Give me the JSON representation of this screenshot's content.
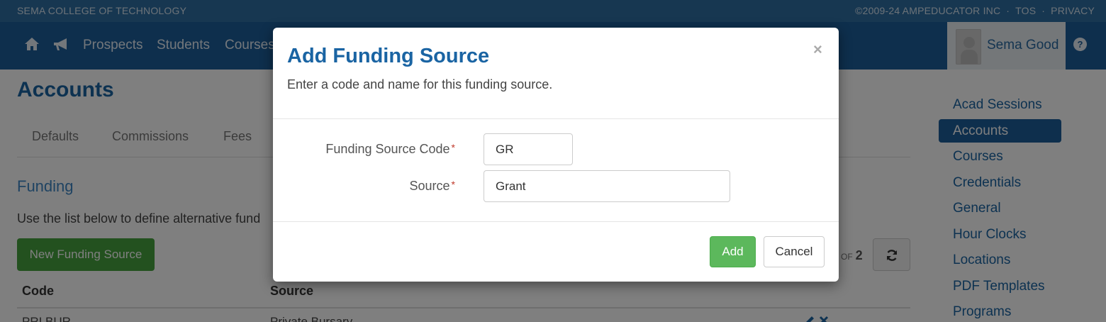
{
  "topbar": {
    "school": "SEMA COLLEGE OF TECHNOLOGY",
    "copyright": "©2009-24 AMPEDUCATOR INC",
    "tos": "TOS",
    "privacy": "PRIVACY",
    "separator": "·"
  },
  "nav": {
    "icons": [
      "home-icon",
      "megaphone-icon"
    ],
    "items": [
      "Prospects",
      "Students",
      "Courses"
    ],
    "user_name": "Sema Good",
    "help_icon": "question-circle-icon"
  },
  "page": {
    "title": "Accounts",
    "tabs": [
      "Defaults",
      "Commissions",
      "Fees"
    ],
    "section_title": "Funding",
    "description": "Use the list below to define alternative fund",
    "new_button": "New Funding Source",
    "of_label": "OF",
    "of_total": "2",
    "table": {
      "headers": [
        "Code",
        "Source"
      ],
      "rows": [
        [
          "PRI BUR",
          "Private Bursary"
        ]
      ]
    }
  },
  "sidebar": {
    "items": [
      "Acad Sessions",
      "Accounts",
      "Courses",
      "Credentials",
      "General",
      "Hour Clocks",
      "Locations",
      "PDF Templates",
      "Programs"
    ],
    "active": "Accounts"
  },
  "modal": {
    "title": "Add Funding Source",
    "subtitle": "Enter a code and name for this funding source.",
    "close": "×",
    "fields": {
      "code_label": "Funding Source Code",
      "code_value": "GR",
      "source_label": "Source",
      "source_value": "Grant",
      "required_mark": "*"
    },
    "add_button": "Add",
    "cancel_button": "Cancel"
  },
  "colors": {
    "nav_bg": "#1c5e9b",
    "accent": "#1a64a3",
    "add_green": "#5cb85c",
    "new_green": "#46a33f"
  }
}
